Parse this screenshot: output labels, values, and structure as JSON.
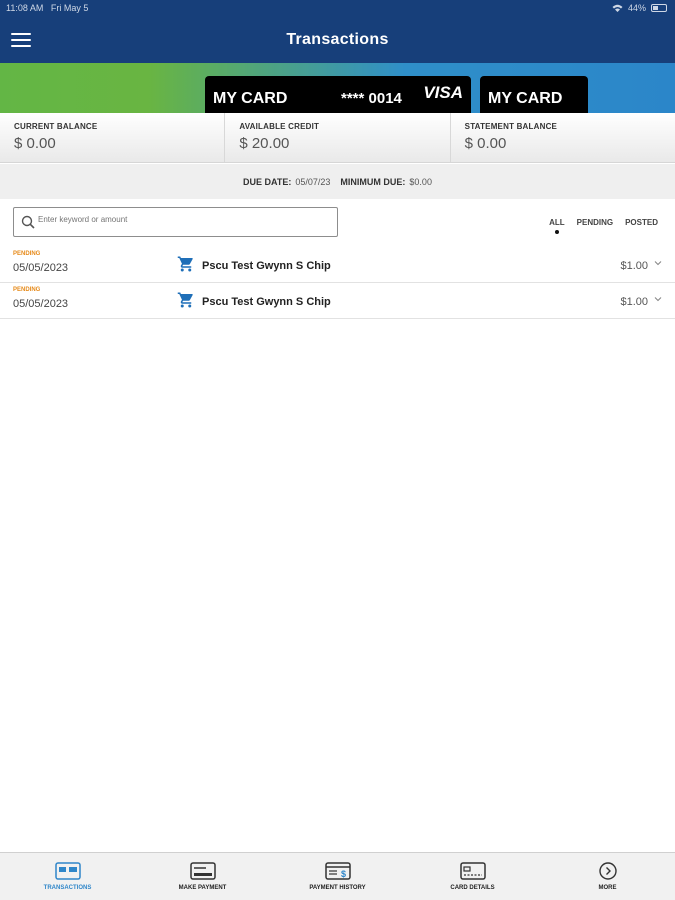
{
  "status_bar": {
    "time": "11:08 AM",
    "date": "Fri May 5",
    "battery": "44%"
  },
  "header": {
    "title": "Transactions"
  },
  "cards": [
    {
      "name": "MY CARD",
      "mask": "**** 0014",
      "brand": "VISA"
    },
    {
      "name": "MY CARD"
    }
  ],
  "balances": [
    {
      "label": "CURRENT BALANCE",
      "value": "$ 0.00"
    },
    {
      "label": "AVAILABLE CREDIT",
      "value": "$ 20.00"
    },
    {
      "label": "STATEMENT BALANCE",
      "value": "$ 0.00"
    }
  ],
  "due": {
    "due_label": "DUE DATE:",
    "due_value": "05/07/23",
    "min_label": "MINIMUM DUE:",
    "min_value": "$0.00"
  },
  "search": {
    "placeholder": "Enter keyword or amount"
  },
  "filters": [
    "ALL",
    "PENDING",
    "POSTED"
  ],
  "transactions": [
    {
      "status": "PENDING",
      "date": "05/05/2023",
      "merchant": "Pscu Test Gwynn S Chip",
      "amount": "$1.00"
    },
    {
      "status": "PENDING",
      "date": "05/05/2023",
      "merchant": "Pscu Test Gwynn S Chip",
      "amount": "$1.00"
    }
  ],
  "tabs": [
    {
      "label": "TRANSACTIONS",
      "icon": "transactions-icon"
    },
    {
      "label": "MAKE PAYMENT",
      "icon": "payment-card-icon"
    },
    {
      "label": "PAYMENT HISTORY",
      "icon": "payment-history-icon"
    },
    {
      "label": "CARD DETAILS",
      "icon": "card-details-icon"
    },
    {
      "label": "MORE",
      "icon": "chevron-circle-icon"
    }
  ],
  "colors": {
    "header": "#173f7a",
    "accent": "#2f86c9",
    "pending": "#e68a1a",
    "banner_green": "#63b645",
    "banner_blue": "#2b86c9"
  }
}
